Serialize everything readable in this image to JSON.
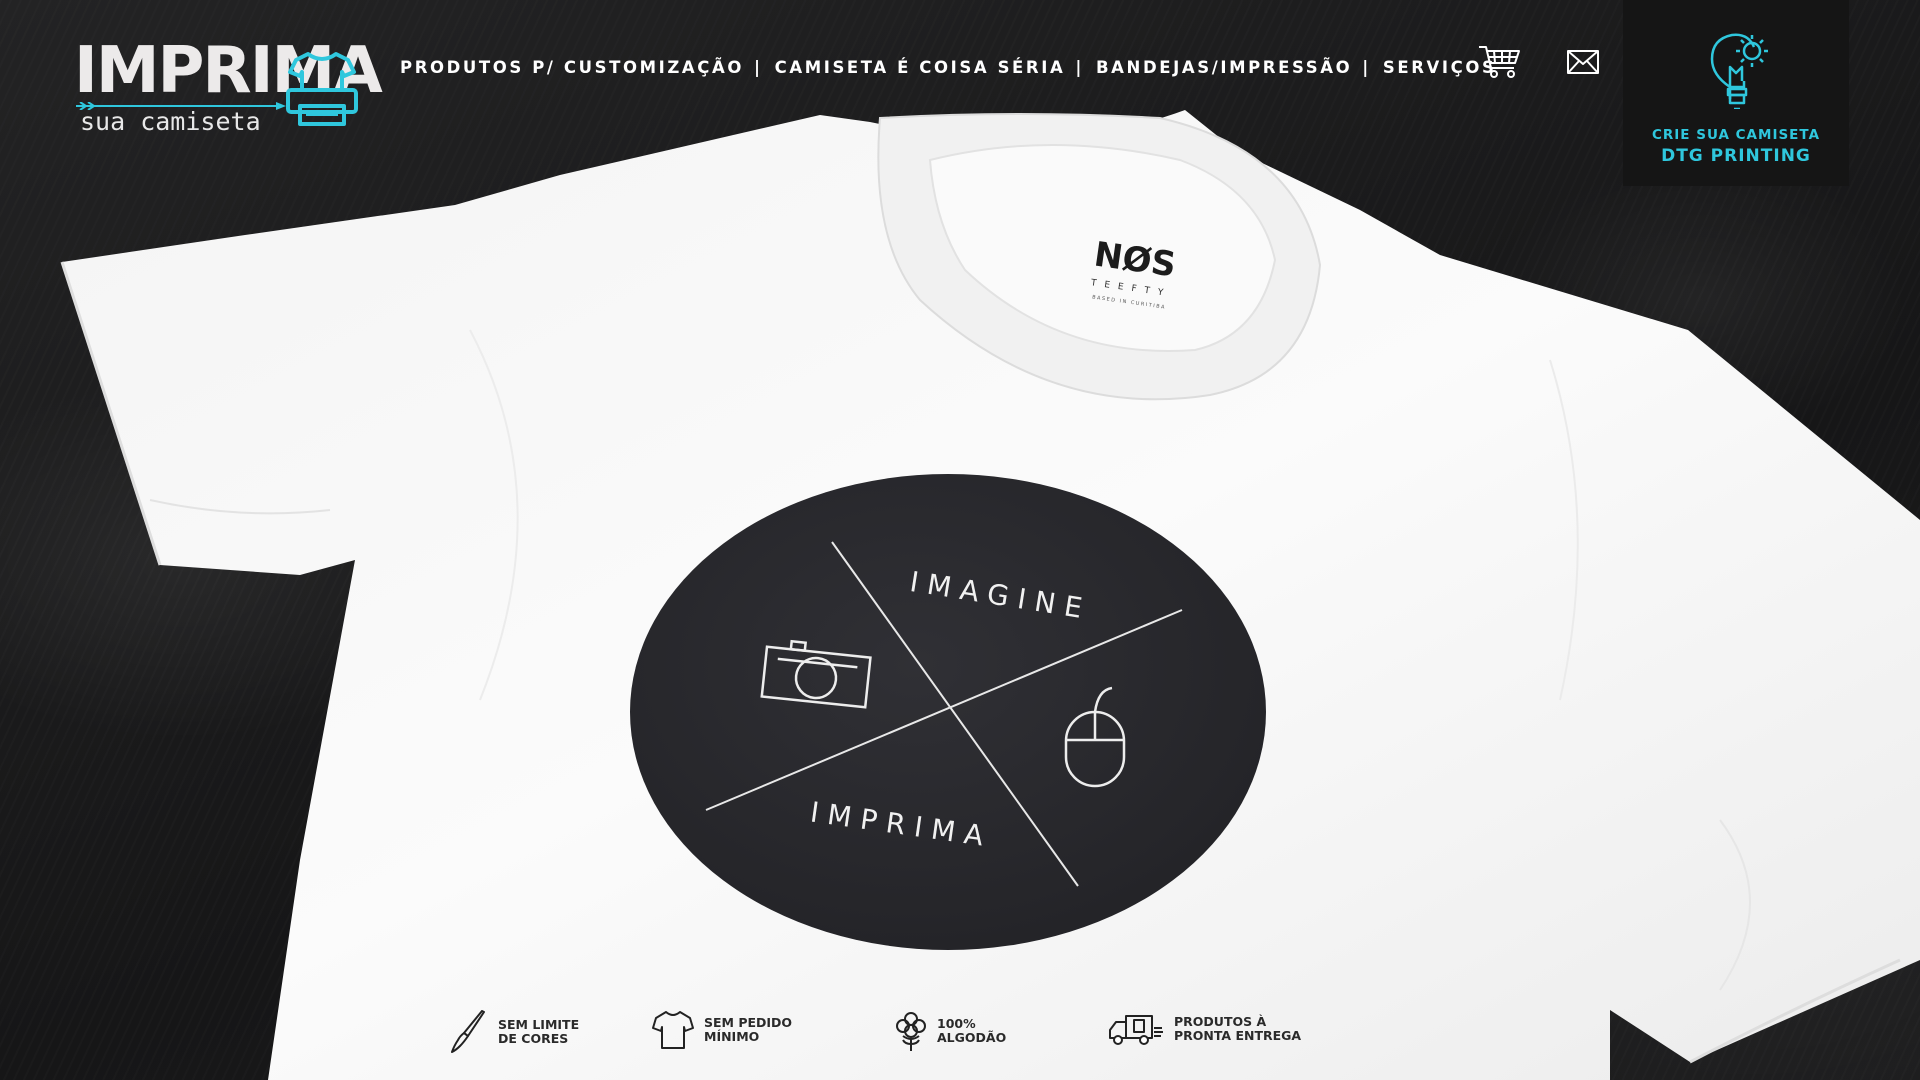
{
  "logo": {
    "main": "IMPRIMA",
    "sub": "sua camiseta",
    "icon": "tshirt-printer-icon"
  },
  "nav": {
    "items": [
      {
        "label": "PRODUTOS P/ CUSTOMIZAÇÃO"
      },
      {
        "label": "CAMISETA É COISA SÉRIA"
      },
      {
        "label": "BANDEJAS/IMPRESSÃO"
      },
      {
        "label": "SERVIÇOS"
      }
    ],
    "separator": "|"
  },
  "header_icons": {
    "cart": "shopping-cart-icon",
    "mail": "envelope-icon"
  },
  "cta": {
    "line1": "CRIE  SUA CAMISETA",
    "line2": "DTG PRINTING",
    "icon": "lightbulb-gear-icon",
    "color": "#2fc7dd"
  },
  "shirt_label": {
    "brand": "NØS",
    "sub": "TEEFTY",
    "tag": "BASED IN CURITIBA"
  },
  "print": {
    "top_word": "IMAGINE",
    "bottom_word": "IMPRIMA",
    "icons": [
      "camera-icon",
      "mouse-icon"
    ]
  },
  "features": [
    {
      "line1": "SEM LIMITE",
      "line2": "DE CORES",
      "icon": "paintbrush-icon"
    },
    {
      "line1": "SEM PEDIDO",
      "line2": "MÍNIMO",
      "icon": "tshirt-icon"
    },
    {
      "line1": "100%",
      "line2": "ALGODÃO",
      "icon": "cotton-icon"
    },
    {
      "line1": "PRODUTOS À",
      "line2": "PRONTA ENTREGA",
      "icon": "delivery-truck-icon"
    }
  ],
  "colors": {
    "accent": "#2fc7dd",
    "background": "#1b1b1c",
    "shirt": "#f6f6f6",
    "print": "#27272b"
  }
}
